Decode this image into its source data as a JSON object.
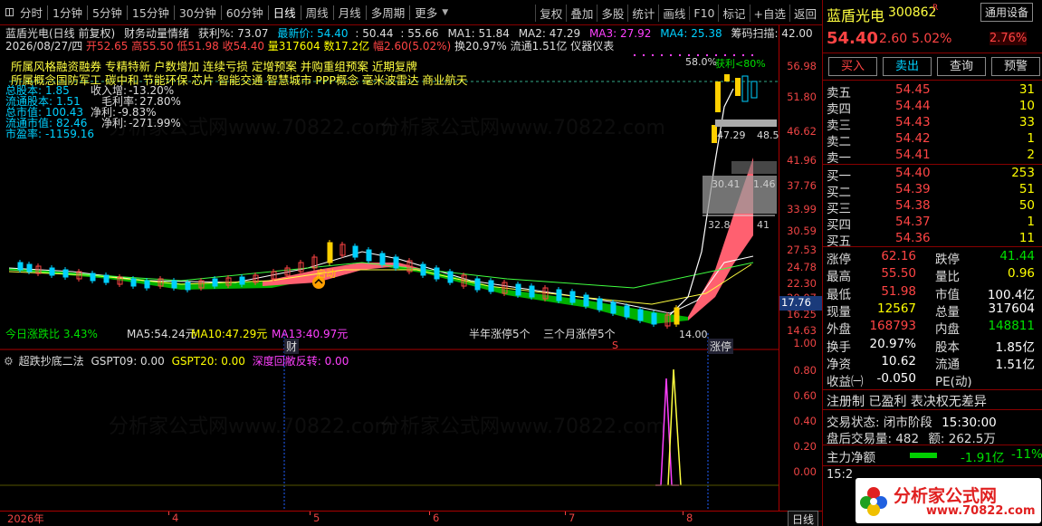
{
  "toolbar": {
    "periods": [
      "分时",
      "1分钟",
      "5分钟",
      "15分钟",
      "30分钟",
      "60分钟",
      "日线",
      "周线",
      "月线",
      "多周期",
      "更多"
    ],
    "active_period": "日线",
    "tools": [
      "复权",
      "叠加",
      "多股",
      "统计",
      "画线",
      "F10",
      "标记",
      "+自选",
      "返回"
    ]
  },
  "stock": {
    "name": "蓝盾光电",
    "code": "300862",
    "tag": "通用设备",
    "tag_pct": "2.76%",
    "price": "54.40",
    "change": "2.60",
    "change_pct": "5.02%"
  },
  "header": {
    "title": "蓝盾光电(日线 前复权)",
    "indicator_name": "财务动量情绪",
    "profit_label": "获利%: 73.07",
    "latest_label": "最新价: 54.40",
    "v1": ": 50.44",
    "v2": ": 55.66",
    "ma1": "MA1: 51.84",
    "ma2": "MA2: 47.29",
    "ma3": "MA3: 27.92",
    "ma4": "MA4: 25.38",
    "chip_scan": "筹码扫描: 42.00",
    "date": "2026/08/27/四",
    "open": "开52.65",
    "high": "高55.50",
    "low": "低51.98",
    "close": "收54.40",
    "volume": "量317604",
    "amount": "数17.2亿",
    "amplitude": "幅2.60(5.02%)",
    "turnover": "换20.97%",
    "float": "流通1.51亿",
    "instrument": "仪器仪表"
  },
  "concepts_line1": "所属风格融资融券 专精特新 户数增加 连续亏损 定增预案 并购重组预案 近期复牌",
  "concepts_line2": "所属概念国防军工 碳中和 节能环保 芯片 智能交通 智慧城市 PPP概念 毫米波雷达 商业航天",
  "fundamentals": [
    [
      "总股本:",
      "1.85",
      "收入增:",
      "-13.20%"
    ],
    [
      "流通股本:",
      "1.51",
      "毛利率:",
      "27.80%"
    ],
    [
      "总市值:",
      "100.43",
      "净利:",
      "-9.83%"
    ],
    [
      "流通市值:",
      "82.46",
      "净利:",
      "-271.99%"
    ],
    [
      "市盈率:",
      "-1159.16",
      "",
      ""
    ]
  ],
  "chart_annotations": {
    "profit_top": "58.0%",
    "profit_pct": "获利<80%",
    "levels": [
      "47.29",
      "48.5",
      "30.41",
      "1.46",
      "32.8",
      "41"
    ],
    "qidong": "启动",
    "bottom_left": "今日涨跌比 3.43%",
    "ma5": "MA5:54.24元",
    "ma10": "MA10:47.29元",
    "ma13": "MA13:40.97元",
    "half_year": "半年涨停5个",
    "three_month": "三个月涨停5个",
    "low_mark": "14.00",
    "cai": "财",
    "zhangting": "涨停",
    "s_mark": "S",
    "scale_highlight": "17.76",
    "y_ticks": [
      "56.98",
      "51.80",
      "46.62",
      "41.96",
      "37.76",
      "33.99",
      "30.59",
      "27.53",
      "24.78",
      "22.30",
      "20.07",
      "16.25",
      "14.63"
    ]
  },
  "sub_chart": {
    "title": "超跌抄底二法",
    "gspt09": "GSPT09: 0.00",
    "gspt20": "GSPT20: 0.00",
    "deep": "深度回敝反转: 0.00",
    "y_ticks": [
      "1.00",
      "0.80",
      "0.60",
      "0.40",
      "0.20",
      "0.00"
    ]
  },
  "x_axis": {
    "labels": [
      "2026年",
      "4",
      "5",
      "6",
      "7",
      "8"
    ],
    "end_tab": "日线"
  },
  "panel": {
    "buttons": [
      "买入",
      "卖出",
      "查询",
      "预警"
    ],
    "sell": [
      [
        "卖五",
        "54.45",
        "31"
      ],
      [
        "卖四",
        "54.44",
        "10"
      ],
      [
        "卖三",
        "54.43",
        "33"
      ],
      [
        "卖二",
        "54.42",
        "1"
      ],
      [
        "卖一",
        "54.41",
        "2"
      ]
    ],
    "buy": [
      [
        "买一",
        "54.40",
        "253"
      ],
      [
        "买二",
        "54.39",
        "51"
      ],
      [
        "买三",
        "54.38",
        "50"
      ],
      [
        "买四",
        "54.37",
        "1"
      ],
      [
        "买五",
        "54.36",
        "11"
      ]
    ],
    "stats": [
      [
        "涨停",
        "62.16",
        "跌停",
        "41.44"
      ],
      [
        "最高",
        "55.50",
        "量比",
        "0.96"
      ],
      [
        "最低",
        "51.98",
        "市值",
        "100.4亿"
      ],
      [
        "现量",
        "12567",
        "总量",
        "317604"
      ],
      [
        "外盘",
        "168793",
        "内盘",
        "148811"
      ],
      [
        "换手",
        "20.97%",
        "股本",
        "1.85亿"
      ],
      [
        "净资",
        "10.62",
        "流通",
        "1.51亿"
      ],
      [
        "收益㈠",
        "-0.050",
        "PE(动)",
        ""
      ]
    ],
    "notice": "注册制 已盈利 表决权无差异",
    "trade_status_label": "交易状态: 闭市阶段",
    "trade_time": "15:30:00",
    "after_label": "盘后交易量: 482",
    "after_amount": "额: 262.5万",
    "main_flow_label": "主力净额",
    "main_flow_value": "-1.91亿",
    "main_flow_pct": "-11%",
    "tick_time": "15:2",
    "logo_text": "分析家公式网",
    "logo_url": "www.70822.com"
  },
  "watermark": "分析家公式网www.70822.com"
}
